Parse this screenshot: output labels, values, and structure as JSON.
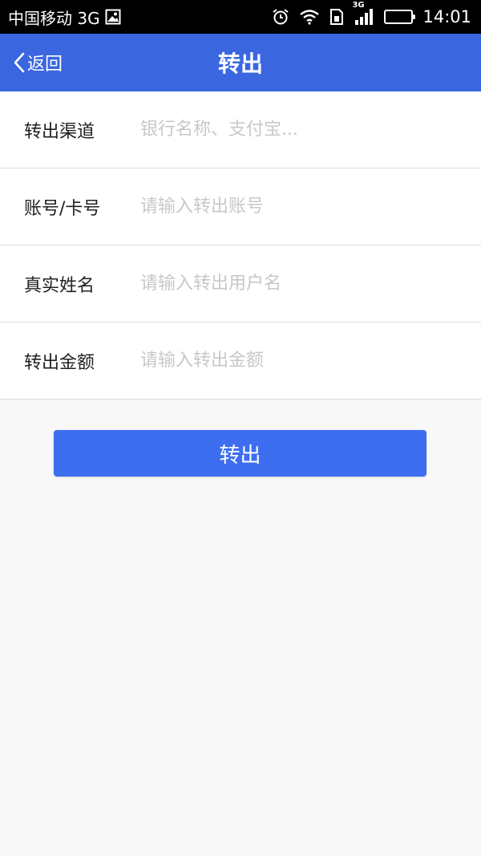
{
  "statusbar": {
    "carrier": "中国移动 3G",
    "network_badge": "3G",
    "time": "14:01",
    "icons": [
      "image-icon",
      "alarm-icon",
      "wifi-icon",
      "sim-icon",
      "signal-icon",
      "battery-icon"
    ]
  },
  "navbar": {
    "back_label": "返回",
    "title": "转出"
  },
  "form": {
    "rows": [
      {
        "label": "转出渠道",
        "placeholder": "银行名称、支付宝..."
      },
      {
        "label": "账号/卡号",
        "placeholder": "请输入转出账号"
      },
      {
        "label": "真实姓名",
        "placeholder": "请输入转出用户名"
      },
      {
        "label": "转出金额",
        "placeholder": "请输入转出金额"
      }
    ]
  },
  "submit": {
    "label": "转出"
  },
  "colors": {
    "accent": "#3a66e0",
    "button": "#3d6ef0",
    "background": "#f8f8f8",
    "placeholder": "#c8c8c8"
  }
}
